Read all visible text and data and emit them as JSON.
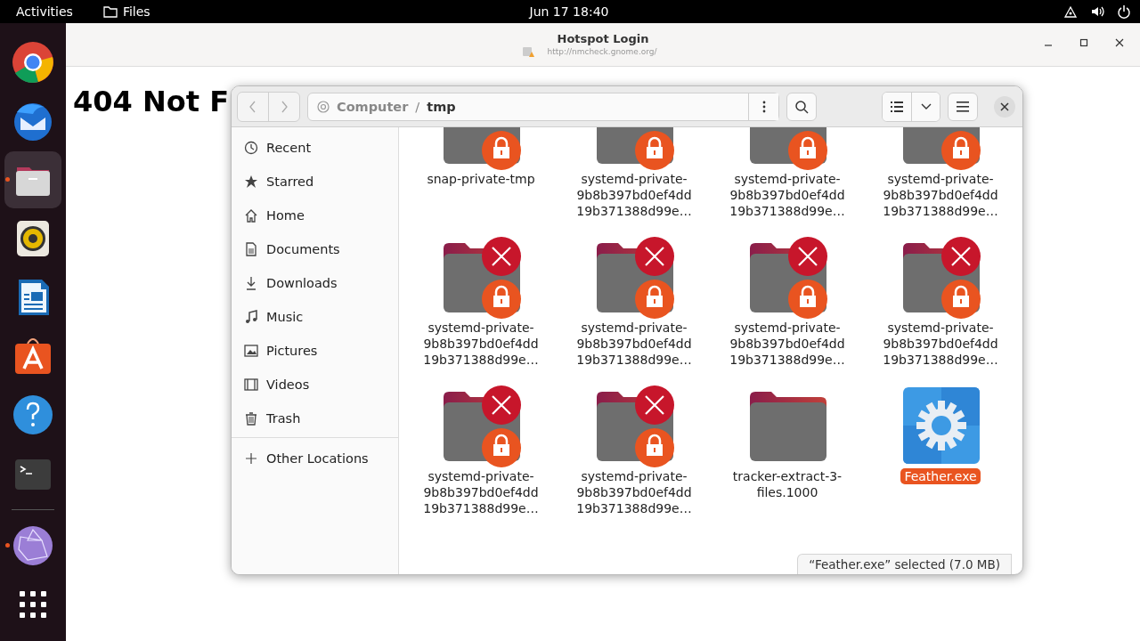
{
  "top_bar": {
    "activities": "Activities",
    "app": "Files",
    "clock": "Jun 17  18:40"
  },
  "dock": [
    {
      "kind": "browser",
      "running": false,
      "selected": false
    },
    {
      "kind": "mail",
      "running": false,
      "selected": false
    },
    {
      "kind": "files",
      "running": true,
      "selected": true
    },
    {
      "kind": "music",
      "running": false,
      "selected": false
    },
    {
      "kind": "document",
      "running": false,
      "selected": false
    },
    {
      "kind": "store",
      "running": false,
      "selected": false
    },
    {
      "kind": "help",
      "running": false,
      "selected": false
    },
    {
      "kind": "terminal",
      "running": false,
      "selected": false
    },
    {
      "kind": "separator"
    },
    {
      "kind": "globe",
      "running": true,
      "selected": false
    },
    {
      "kind": "apps",
      "running": false,
      "selected": false
    }
  ],
  "browser_window": {
    "title": "Hotspot Login",
    "url": "http://nmcheck.gnome.org/",
    "heading": "404 Not F"
  },
  "files_window": {
    "path": [
      {
        "label": "Computer",
        "current": false
      },
      {
        "label": "tmp",
        "current": true
      }
    ],
    "path_separator": "/",
    "sidebar": [
      {
        "label": "Recent",
        "kind": "recent",
        "selected": false
      },
      {
        "label": "Starred",
        "kind": "star",
        "selected": false
      },
      {
        "label": "Home",
        "kind": "home",
        "selected": false
      },
      {
        "label": "Documents",
        "kind": "document",
        "selected": false
      },
      {
        "label": "Downloads",
        "kind": "download",
        "selected": false
      },
      {
        "label": "Music",
        "kind": "music",
        "selected": false
      },
      {
        "label": "Pictures",
        "kind": "picture",
        "selected": false
      },
      {
        "label": "Videos",
        "kind": "video",
        "selected": false
      },
      {
        "label": "Trash",
        "kind": "trash",
        "selected": false
      }
    ],
    "other_locations": "Other Locations",
    "items": [
      {
        "name": "snap-private-tmp",
        "kind": "folder",
        "locked": true,
        "no_access": false,
        "selected": false
      },
      {
        "name": "systemd-private-\n9b8b397bd0ef4dd\n19b371388d99e…",
        "kind": "folder",
        "locked": true,
        "no_access": false,
        "selected": false
      },
      {
        "name": "systemd-private-\n9b8b397bd0ef4dd\n19b371388d99e…",
        "kind": "folder",
        "locked": true,
        "no_access": false,
        "selected": false
      },
      {
        "name": "systemd-private-\n9b8b397bd0ef4dd\n19b371388d99e…",
        "kind": "folder",
        "locked": true,
        "no_access": false,
        "selected": false
      },
      {
        "name": "systemd-private-\n9b8b397bd0ef4dd\n19b371388d99e…",
        "kind": "folder",
        "locked": true,
        "no_access": true,
        "selected": false
      },
      {
        "name": "systemd-private-\n9b8b397bd0ef4dd\n19b371388d99e…",
        "kind": "folder",
        "locked": true,
        "no_access": true,
        "selected": false
      },
      {
        "name": "systemd-private-\n9b8b397bd0ef4dd\n19b371388d99e…",
        "kind": "folder",
        "locked": true,
        "no_access": true,
        "selected": false
      },
      {
        "name": "systemd-private-\n9b8b397bd0ef4dd\n19b371388d99e…",
        "kind": "folder",
        "locked": true,
        "no_access": true,
        "selected": false
      },
      {
        "name": "systemd-private-\n9b8b397bd0ef4dd\n19b371388d99e…",
        "kind": "folder",
        "locked": true,
        "no_access": true,
        "selected": false
      },
      {
        "name": "systemd-private-\n9b8b397bd0ef4dd\n19b371388d99e…",
        "kind": "folder",
        "locked": true,
        "no_access": true,
        "selected": false
      },
      {
        "name": "tracker-extract-3-\nfiles.1000",
        "kind": "folder",
        "locked": false,
        "no_access": false,
        "selected": false
      },
      {
        "name": "Feather.exe",
        "kind": "executable",
        "locked": false,
        "no_access": false,
        "selected": true
      }
    ],
    "status": "“Feather.exe” selected (7.0 MB)"
  }
}
